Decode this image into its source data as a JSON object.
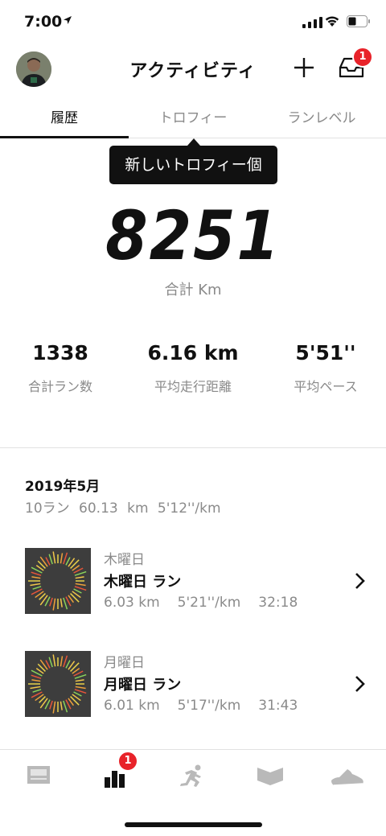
{
  "status_bar": {
    "time": "7:00"
  },
  "header": {
    "title": "アクティビティ",
    "inbox_badge": "1"
  },
  "tabs": [
    {
      "label": "履歴",
      "active": true
    },
    {
      "label": "トロフィー",
      "active": false
    },
    {
      "label": "ランレベル",
      "active": false
    }
  ],
  "tooltip": {
    "text": "新しいトロフィー個"
  },
  "summary": {
    "total_km": "8251",
    "total_label": "合計 Km",
    "stats": [
      {
        "value": "1338",
        "label": "合計ラン数"
      },
      {
        "value": "6.16 km",
        "label": "平均走行距離"
      },
      {
        "value": "5'51''",
        "label": "平均ペース"
      }
    ]
  },
  "month": {
    "title": "2019年5月",
    "summary": "10ラン  60.13 km  5'12''/km"
  },
  "runs": [
    {
      "day": "木曜日",
      "name": "木曜日 ラン",
      "distance": "6.03 km",
      "pace": "5'21''/km",
      "time": "32:18"
    },
    {
      "day": "月曜日",
      "name": "月曜日 ラン",
      "distance": "6.01 km",
      "pace": "5'17''/km",
      "time": "31:43"
    }
  ],
  "bottom_nav": {
    "items": [
      "feed-icon",
      "activity-icon",
      "run-icon",
      "club-icon",
      "shoe-icon"
    ],
    "activity_badge": "1"
  },
  "colors": {
    "badge": "#e8232a",
    "muted": "#8a8a8a"
  }
}
